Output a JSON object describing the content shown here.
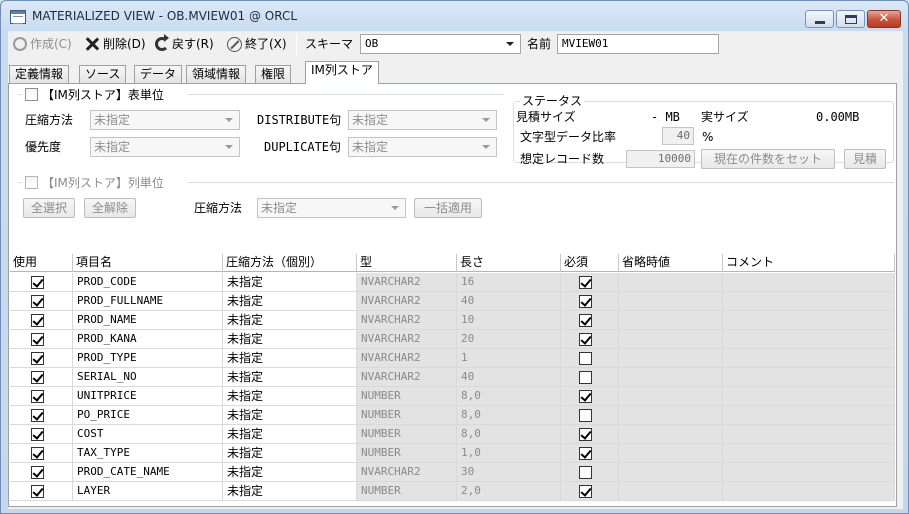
{
  "window": {
    "title": "MATERIALIZED VIEW - OB.MVIEW01 @ ORCL"
  },
  "toolbar": {
    "create": "作成(C)",
    "delete": "削除(D)",
    "revert": "戻す(R)",
    "exit": "終了(X)",
    "schema_label": "スキーマ",
    "schema_value": "OB",
    "name_label": "名前",
    "name_value": "MVIEW01"
  },
  "tabs": [
    "定義情報",
    "ソース",
    "データ",
    "領域情報",
    "権限",
    "IM列ストア"
  ],
  "table_unit": {
    "checkbox_label": "【IM列ストア】表単位",
    "compression_label": "圧縮方法",
    "compression_value": "未指定",
    "priority_label": "優先度",
    "priority_value": "未指定",
    "distribute_label": "DISTRIBUTE句",
    "distribute_value": "未指定",
    "duplicate_label": "DUPLICATE句",
    "duplicate_value": "未指定"
  },
  "status": {
    "title": "ステータス",
    "estimated_label": "見積サイズ",
    "estimated_value": "- MB",
    "actual_label": "実サイズ",
    "actual_value": "0.00MB",
    "ratio_label": "文字型データ比率",
    "ratio_value": "40",
    "ratio_unit": "%",
    "records_label": "想定レコード数",
    "records_value": "10000",
    "set_count_button": "現在の件数をセット",
    "estimate_button": "見積"
  },
  "column_unit": {
    "checkbox_label": "【IM列ストア】列単位",
    "select_all": "全選択",
    "deselect_all": "全解除",
    "compression_label": "圧縮方法",
    "compression_value": "未指定",
    "apply_all": "一括適用"
  },
  "grid": {
    "headers": [
      "使用",
      "項目名",
      "圧縮方法（個別）",
      "型",
      "長さ",
      "必須",
      "省略時値",
      "コメント"
    ],
    "rows": [
      {
        "use": true,
        "name": "PROD_CODE",
        "compression": "未指定",
        "type": "NVARCHAR2",
        "length": "16",
        "required": true
      },
      {
        "use": true,
        "name": "PROD_FULLNAME",
        "compression": "未指定",
        "type": "NVARCHAR2",
        "length": "40",
        "required": true
      },
      {
        "use": true,
        "name": "PROD_NAME",
        "compression": "未指定",
        "type": "NVARCHAR2",
        "length": "10",
        "required": true
      },
      {
        "use": true,
        "name": "PROD_KANA",
        "compression": "未指定",
        "type": "NVARCHAR2",
        "length": "20",
        "required": true
      },
      {
        "use": true,
        "name": "PROD_TYPE",
        "compression": "未指定",
        "type": "NVARCHAR2",
        "length": "1",
        "required": false
      },
      {
        "use": true,
        "name": "SERIAL_NO",
        "compression": "未指定",
        "type": "NVARCHAR2",
        "length": "40",
        "required": false
      },
      {
        "use": true,
        "name": "UNITPRICE",
        "compression": "未指定",
        "type": "NUMBER",
        "length": "8,0",
        "required": true
      },
      {
        "use": true,
        "name": "PO_PRICE",
        "compression": "未指定",
        "type": "NUMBER",
        "length": "8,0",
        "required": false
      },
      {
        "use": true,
        "name": "COST",
        "compression": "未指定",
        "type": "NUMBER",
        "length": "8,0",
        "required": true
      },
      {
        "use": true,
        "name": "TAX_TYPE",
        "compression": "未指定",
        "type": "NUMBER",
        "length": "1,0",
        "required": true
      },
      {
        "use": true,
        "name": "PROD_CATE_NAME",
        "compression": "未指定",
        "type": "NVARCHAR2",
        "length": "30",
        "required": false
      },
      {
        "use": true,
        "name": "LAYER",
        "compression": "未指定",
        "type": "NUMBER",
        "length": "2,0",
        "required": true
      }
    ]
  }
}
